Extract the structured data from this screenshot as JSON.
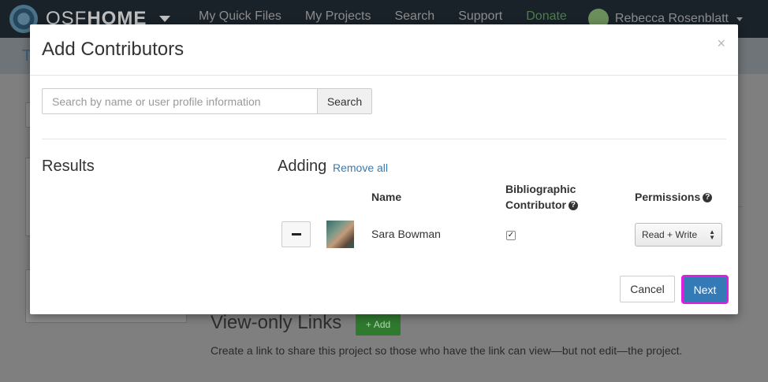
{
  "navbar": {
    "brand_prefix": "OSF",
    "brand_suffix": "HOME",
    "links": [
      "My Quick Files",
      "My Projects",
      "Search",
      "Support"
    ],
    "donate": "Donate",
    "user_name": "Rebecca Rosenblatt"
  },
  "background": {
    "subbar_text": "T",
    "view_only_title": "View-only Links",
    "add_label": "Add",
    "view_only_desc": "Create a link to share this project so those who have the link can view—but not edit—the project."
  },
  "modal": {
    "title": "Add Contributors",
    "close_symbol": "×",
    "search": {
      "placeholder": "Search by name or user profile information",
      "value": "",
      "button_label": "Search"
    },
    "results_title": "Results",
    "adding_title": "Adding",
    "remove_all": "Remove all",
    "columns": {
      "name": "Name",
      "bibliographic_line1": "Bibliographic",
      "bibliographic_line2": "Contributor",
      "permissions": "Permissions"
    },
    "contributors": [
      {
        "name": "Sara Bowman",
        "bibliographic": true,
        "permission": "Read + Write"
      }
    ],
    "buttons": {
      "cancel": "Cancel",
      "next": "Next"
    }
  },
  "colors": {
    "primary": "#337ab7",
    "highlight": "#e01ee0",
    "navbar": "#1a2229"
  }
}
